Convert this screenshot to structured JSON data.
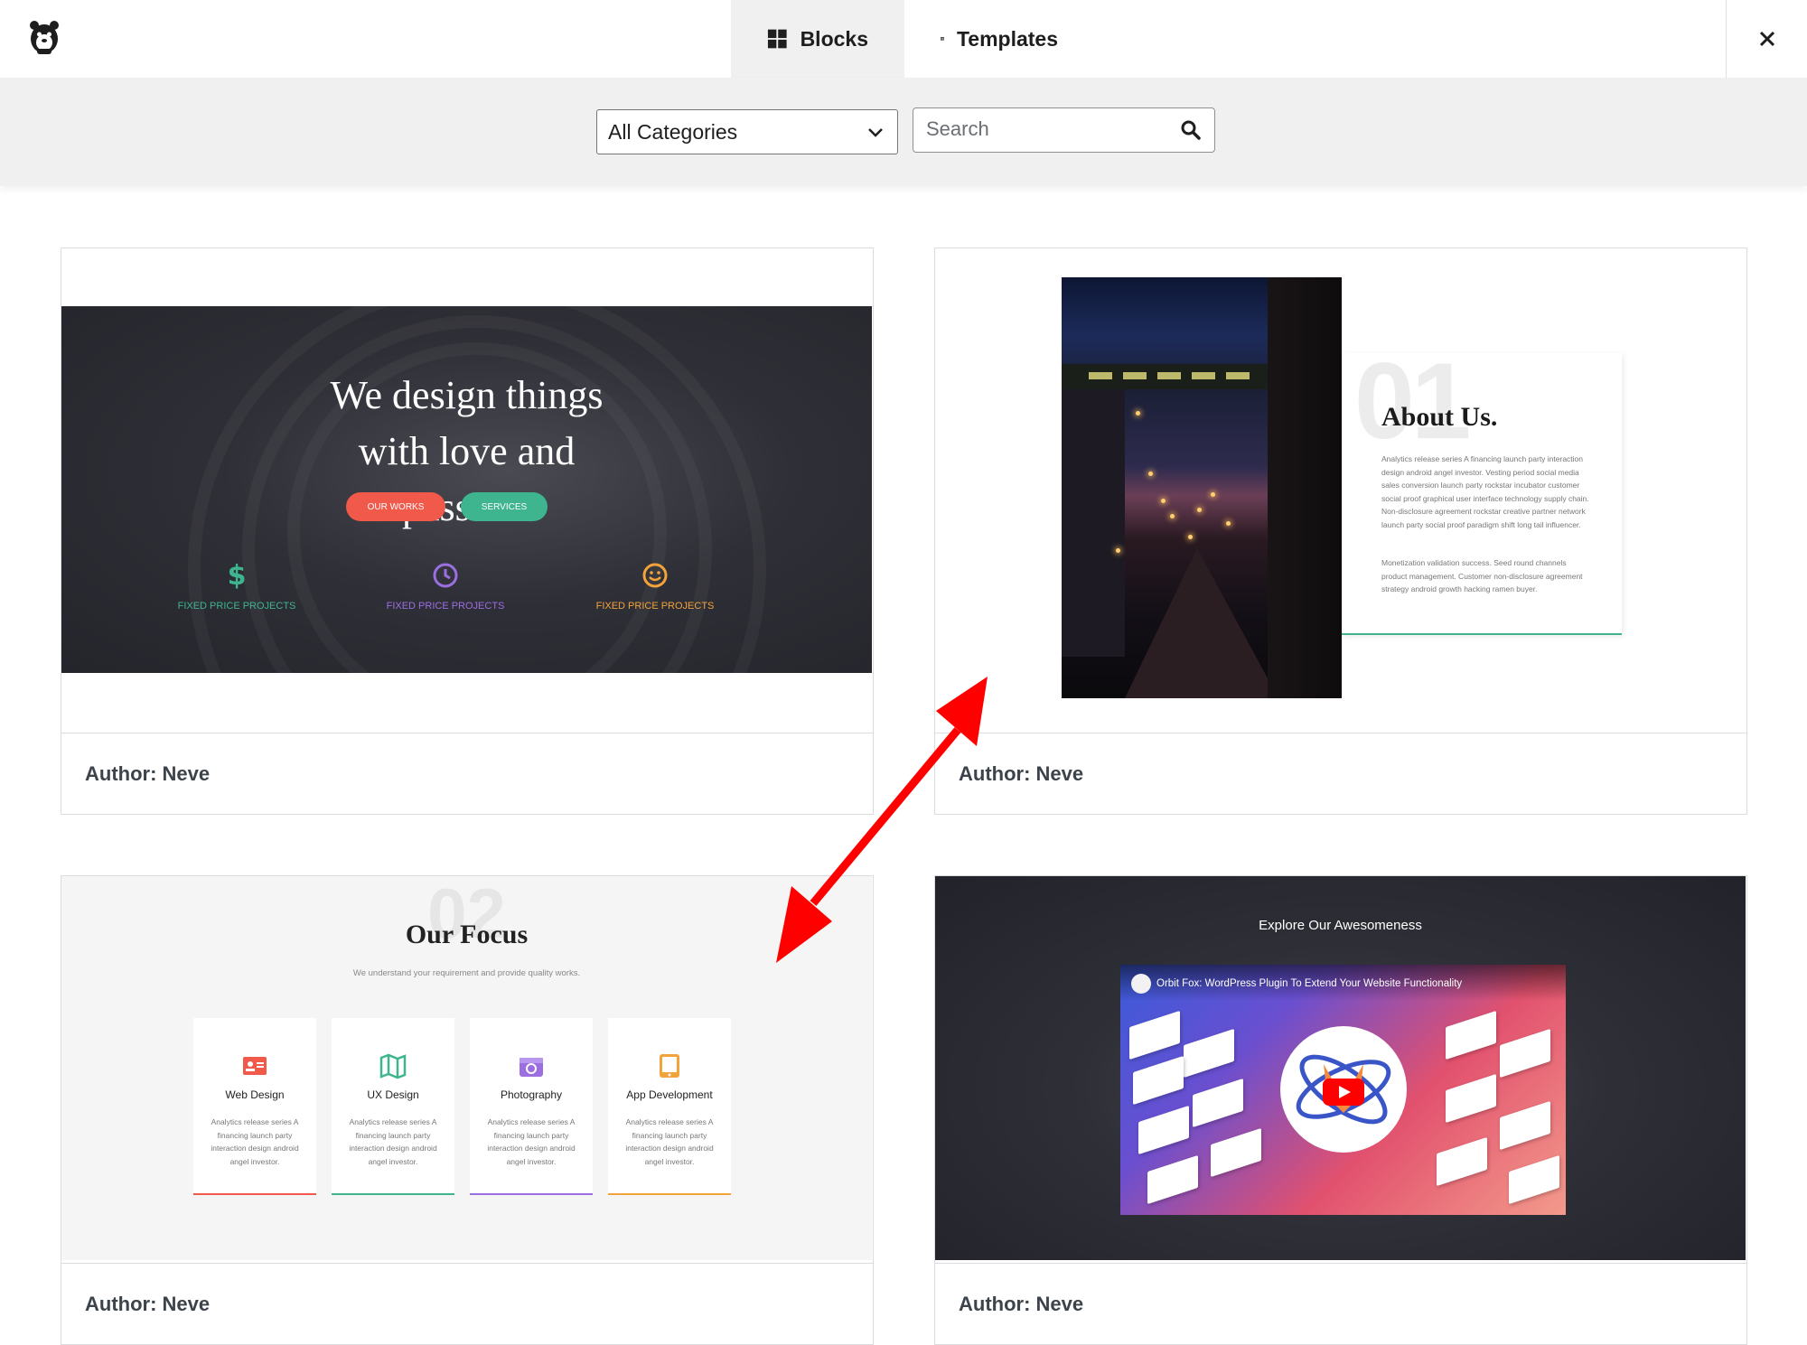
{
  "header": {
    "tabs": [
      {
        "label": "Blocks",
        "icon": "grid-icon",
        "active": true
      },
      {
        "label": "Templates",
        "icon": "table-layout-icon",
        "active": false
      }
    ],
    "close_icon": "close-icon",
    "logo_icon": "bear-logo-icon"
  },
  "filters": {
    "category_selected": "All Categories",
    "search_placeholder": "Search"
  },
  "cards": [
    {
      "author": "Author: Neve",
      "preview": {
        "title": "We design things with love and passion.",
        "buttons": [
          "OUR WORKS",
          "SERVICES"
        ],
        "features": [
          {
            "label": "FIXED PRICE PROJECTS",
            "icon": "dollar-icon",
            "color": "#3eb58f"
          },
          {
            "label": "FIXED PRICE PROJECTS",
            "icon": "clock-icon",
            "color": "#9b6fe0"
          },
          {
            "label": "FIXED PRICE PROJECTS",
            "icon": "smiley-icon",
            "color": "#f2a33a"
          }
        ]
      }
    },
    {
      "author": "Author: Neve",
      "preview": {
        "number": "01",
        "title": "About Us.",
        "para1": "Analytics release series A financing launch party interaction design android angel investor. Vesting period social media sales conversion launch party rockstar incubator customer social proof graphical user interface technology supply chain. Non-disclosure agreement rockstar creative partner network launch party social proof paradigm shift long tail influencer.",
        "para2": "Monetization validation success. Seed round channels product management. Customer non-disclosure agreement strategy android growth hacking ramen buyer."
      }
    },
    {
      "author": "Author: Neve",
      "preview": {
        "number": "02",
        "title": "Our Focus",
        "subtitle": "We understand your requirement and provide quality works.",
        "items": [
          {
            "title": "Web Design",
            "text": "Analytics release series A financing launch party interaction design android angel investor.",
            "icon": "id-card-icon",
            "color": "#f1594a"
          },
          {
            "title": "UX Design",
            "text": "Analytics release series A financing launch party interaction design android angel investor.",
            "icon": "map-icon",
            "color": "#3eb58f"
          },
          {
            "title": "Photography",
            "text": "Analytics release series A financing launch party interaction design android angel investor.",
            "icon": "camera-icon",
            "color": "#9b6fe0"
          },
          {
            "title": "App Development",
            "text": "Analytics release series A financing launch party interaction design android angel investor.",
            "icon": "tablet-icon",
            "color": "#f2a33a"
          }
        ]
      }
    },
    {
      "author": "Author: Neve",
      "preview": {
        "caption": "Explore Our Awesomeness",
        "video_title": "Orbit Fox: WordPress Plugin To Extend Your Website Functionality"
      }
    }
  ],
  "annotation": {
    "type": "double-headed-arrow",
    "color": "#ff0000"
  }
}
